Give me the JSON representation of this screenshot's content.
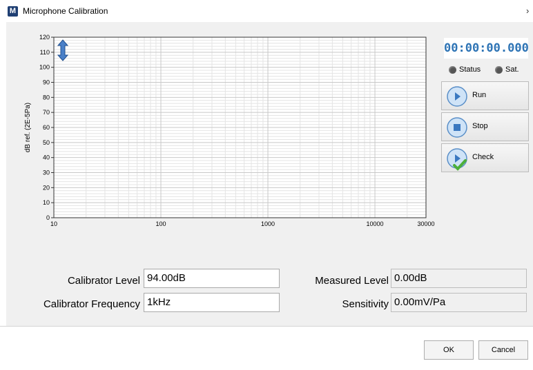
{
  "window": {
    "title": "Microphone Calibration",
    "close_glyph": "›"
  },
  "status": {
    "timer": "00:00:00.000",
    "indicators": [
      {
        "label": "Status"
      },
      {
        "label": "Sat."
      }
    ]
  },
  "actions": {
    "run_label": "Run",
    "stop_label": "Stop",
    "check_label": "Check"
  },
  "form": {
    "calibrator_level_label": "Calibrator Level",
    "calibrator_level_value": "94.00dB",
    "calibrator_frequency_label": "Calibrator Frequency",
    "calibrator_frequency_value": "1kHz",
    "measured_level_label": "Measured Level",
    "measured_level_value": "0.00dB",
    "sensitivity_label": "Sensitivity",
    "sensitivity_value": "0.00mV/Pa"
  },
  "buttons": {
    "ok": "OK",
    "cancel": "Cancel"
  },
  "chart_data": {
    "type": "line",
    "xscale": "log",
    "xlim": [
      10,
      30000
    ],
    "ylim": [
      0,
      120
    ],
    "xticks": [
      10,
      100,
      1000,
      10000,
      30000
    ],
    "yticks": [
      0,
      10,
      20,
      30,
      40,
      50,
      60,
      70,
      80,
      90,
      100,
      110,
      120
    ],
    "ylabel": "dB ref. (2E-5Pa)",
    "xlabel": "",
    "grid": true,
    "series": [],
    "colors": {
      "grid_major": "#c8c8c8",
      "grid_minor": "#e4e4e4",
      "accent": "#2e74b5"
    }
  }
}
